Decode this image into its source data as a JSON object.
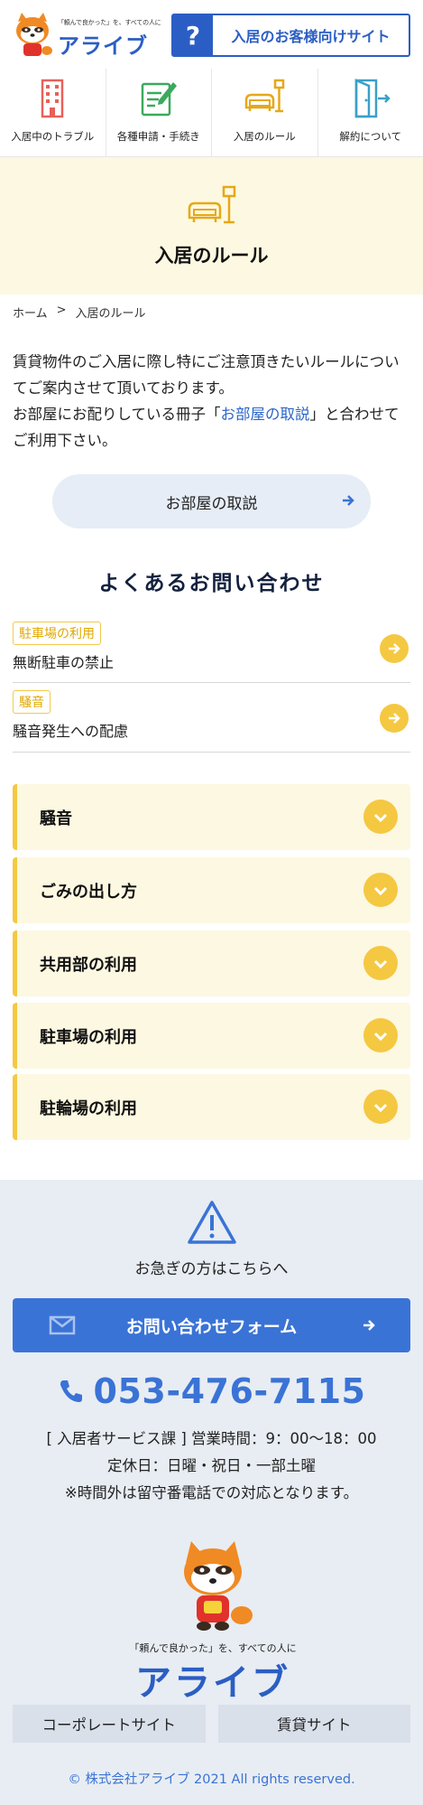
{
  "header": {
    "logo_tagline": "「頼んで良かった」を、すべての人に",
    "logo_name": "アライブ",
    "tenant_site_icon": "?",
    "tenant_site_label": "入居のお客様向けサイト"
  },
  "nav": {
    "items": [
      {
        "label": "入居中のトラブル",
        "icon": "building-icon"
      },
      {
        "label": "各種申請・手続き",
        "icon": "form-pen-icon"
      },
      {
        "label": "入居のルール",
        "icon": "sofa-lamp-icon"
      },
      {
        "label": "解約について",
        "icon": "door-exit-icon"
      }
    ]
  },
  "hero": {
    "title": "入居のルール",
    "icon": "sofa-lamp-icon"
  },
  "breadcrumb": {
    "home": "ホーム",
    "separator": ">",
    "current": "入居のルール"
  },
  "intro": {
    "line1": "賃貸物件のご入居に際し特にご注意頂きたいルールについてご案内させて頂いております。",
    "line2_before": "お部屋にお配りしている冊子「",
    "line2_link": "お部屋の取説",
    "line2_after": "」と合わせてご利用下さい。"
  },
  "guide_button": {
    "label": "お部屋の取説"
  },
  "faq": {
    "title": "よくあるお問い合わせ",
    "items": [
      {
        "tag": "駐車場の利用",
        "text": "無断駐車の禁止"
      },
      {
        "tag": "騒音",
        "text": "騒音発生への配慮"
      }
    ]
  },
  "accordion": {
    "items": [
      {
        "label": "騒音"
      },
      {
        "label": "ごみの出し方"
      },
      {
        "label": "共用部の利用"
      },
      {
        "label": "駐車場の利用"
      },
      {
        "label": "駐輪場の利用"
      }
    ]
  },
  "contact": {
    "urgent": "お急ぎの方はこちらへ",
    "form_label": "お問い合わせフォーム",
    "phone": "053-476-7115",
    "hours_line1": "[ 入居者サービス課 ] 営業時間：9：00～18：00",
    "hours_line2": "定休日：日曜・祝日・一部土曜",
    "hours_line3": "※時間外は留守番電話での対応となります。"
  },
  "footer": {
    "tagline": "「頼んで良かった」を、すべての人に",
    "logo_name": "アライブ",
    "links": [
      "コーポレートサイト",
      "賃貸サイト"
    ],
    "copyright": "© 株式会社アライブ 2021 All rights reserved."
  },
  "colors": {
    "brand_blue": "#2b5ec4",
    "accent_yellow": "#f5c842",
    "hero_bg": "#fdf8e1",
    "contact_bg": "#e8edf3"
  }
}
